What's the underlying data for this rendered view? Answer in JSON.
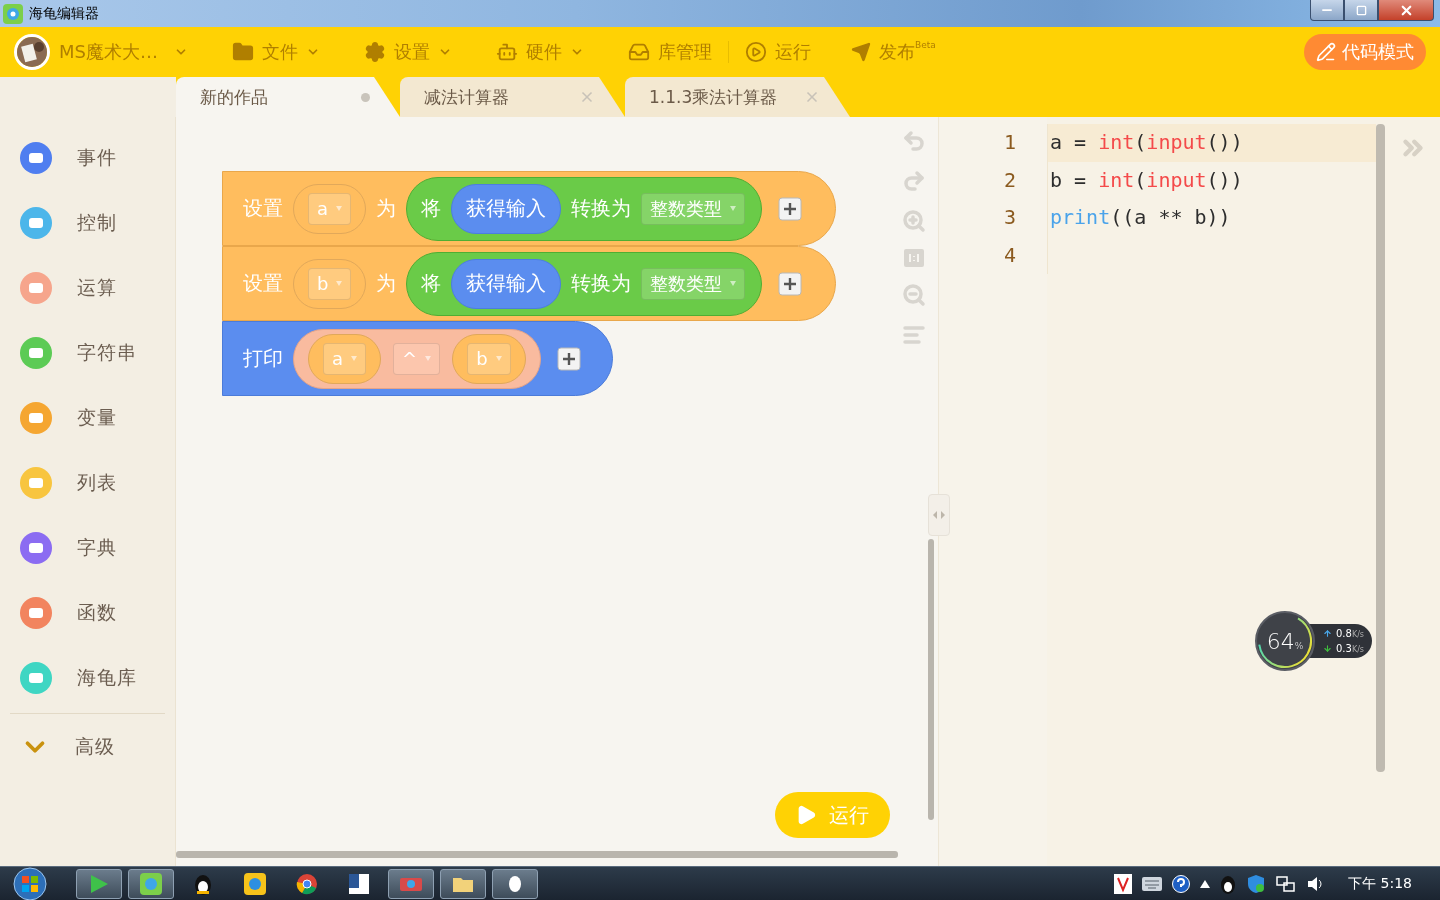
{
  "window": {
    "title": "海龟编辑器"
  },
  "toolbar": {
    "user": "MS魔术大…",
    "menus": [
      {
        "label": "文件",
        "kind": "file",
        "dropdown": true
      },
      {
        "label": "设置",
        "kind": "settings",
        "dropdown": true
      },
      {
        "label": "硬件",
        "kind": "hardware",
        "dropdown": true
      },
      {
        "label": "库管理",
        "kind": "library",
        "dropdown": false
      },
      {
        "label": "运行",
        "kind": "run",
        "dropdown": false
      }
    ],
    "publish": {
      "label": "发布",
      "badge": "Beta"
    },
    "code_mode_button": "代码模式"
  },
  "tabs": [
    {
      "label": "新的作品",
      "selected": true,
      "unsaved": true
    },
    {
      "label": "减法计算器",
      "selected": false,
      "unsaved": false
    },
    {
      "label": "1.1.3乘法计算器",
      "selected": false,
      "unsaved": false
    }
  ],
  "sidebar": {
    "categories": [
      {
        "label": "事件",
        "color": "#4f7ef0"
      },
      {
        "label": "控制",
        "color": "#4cb6ea"
      },
      {
        "label": "运算",
        "color": "#f6a58c"
      },
      {
        "label": "字符串",
        "color": "#5ccb55"
      },
      {
        "label": "变量",
        "color": "#f5a631"
      },
      {
        "label": "列表",
        "color": "#f8c53f"
      },
      {
        "label": "字典",
        "color": "#8b6cf2"
      },
      {
        "label": "函数",
        "color": "#f2845f"
      },
      {
        "label": "海龟库",
        "color": "#3fd6c3"
      }
    ],
    "advanced": {
      "label": "高级",
      "expanded": false
    }
  },
  "blocks": [
    {
      "kind": "set",
      "label": "设置",
      "variable": "a",
      "connector": "为",
      "value": {
        "label": "将",
        "input": "获得输入",
        "middle": "转换为",
        "type": "整数类型"
      }
    },
    {
      "kind": "set",
      "label": "设置",
      "variable": "b",
      "connector": "为",
      "value": {
        "label": "将",
        "input": "获得输入",
        "middle": "转换为",
        "type": "整数类型"
      }
    },
    {
      "kind": "print",
      "label": "打印",
      "args": [
        {
          "kind": "variable",
          "text": "a"
        },
        {
          "kind": "operator",
          "text": "^"
        },
        {
          "kind": "variable",
          "text": "b"
        }
      ]
    }
  ],
  "run_button": "运行",
  "editor": {
    "lines": [
      {
        "number": "1",
        "current": true,
        "tokens": [
          {
            "text": "a = ",
            "kind": "plain"
          },
          {
            "text": "int",
            "kind": "builtin"
          },
          {
            "text": "(",
            "kind": "plain"
          },
          {
            "text": "input",
            "kind": "builtin"
          },
          {
            "text": "())",
            "kind": "plain"
          }
        ]
      },
      {
        "number": "2",
        "current": false,
        "tokens": [
          {
            "text": "b = ",
            "kind": "plain"
          },
          {
            "text": "int",
            "kind": "builtin"
          },
          {
            "text": "(",
            "kind": "plain"
          },
          {
            "text": "input",
            "kind": "builtin"
          },
          {
            "text": "())",
            "kind": "plain"
          }
        ]
      },
      {
        "number": "3",
        "current": false,
        "tokens": [
          {
            "text": "print",
            "kind": "keyword"
          },
          {
            "text": "((a ** b))",
            "kind": "plain"
          }
        ]
      },
      {
        "number": "4",
        "current": false
      }
    ]
  },
  "net_monitor": {
    "percent": "64",
    "percent_unit": "%",
    "up": {
      "value": "0.8",
      "unit": "K/s"
    },
    "down": {
      "value": "0.3",
      "unit": "K/s"
    }
  },
  "taskbar": {
    "clock": "下午 5:18"
  }
}
